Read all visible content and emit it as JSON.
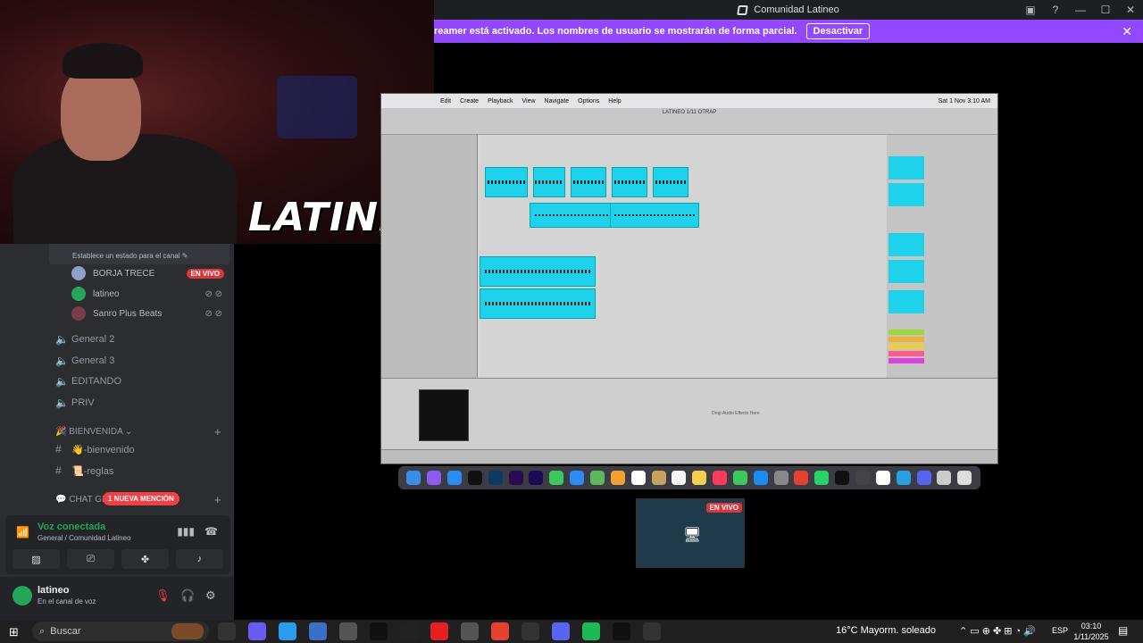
{
  "window": {
    "title": "Comunidad Latineo"
  },
  "banner": {
    "text": "reamer está activado. Los nombres de usuario se mostrarán de forma parcial.",
    "button": "Desactivar"
  },
  "webcam": {
    "logo": "LATINEO"
  },
  "voice_channel": {
    "status_hint": "Establece un estado para el canal",
    "users": [
      {
        "name": "BORJA TRECE",
        "badge": "EN VIVO"
      },
      {
        "name": "latineo"
      },
      {
        "name": "Sanro Plus Beats"
      }
    ]
  },
  "channels": {
    "voice": [
      "General 2",
      "General 3",
      "EDITANDO",
      "PRIV"
    ],
    "category_bienvenida": "BIENVENIDA",
    "text": [
      "👋-bienvenido",
      "📜-reglas"
    ],
    "category_chat": "CHAT GE",
    "mention_badge": "1 NUEVA MENCIÓN"
  },
  "voice_panel": {
    "title": "Voz conectada",
    "subtitle": "General / Comunidad Latineo"
  },
  "user_panel": {
    "name": "latineo",
    "status": "En el canal de voz"
  },
  "stream": {
    "mac_menu": [
      "Edit",
      "Create",
      "Playback",
      "View",
      "Navigate",
      "Options",
      "Help"
    ],
    "mac_clock": "Sat 1 Nov  3:10 AM",
    "project_title": "LATINEO 1/11 OTRAP",
    "drop_hint": "Drop Audio Effects Here"
  },
  "preview": {
    "badge": "EN VIVO"
  },
  "taskbar": {
    "search_placeholder": "Buscar",
    "weather": "16°C  Mayorm. soleado",
    "lang": "ESP",
    "time": "03:10",
    "date": "1/11/2025"
  },
  "colors": {
    "banner": "#9347ff",
    "discord_bg": "#2b2d31",
    "voice_green": "#23a55a",
    "live_red": "#da373c",
    "clip_cyan": "#1ed2ec"
  }
}
